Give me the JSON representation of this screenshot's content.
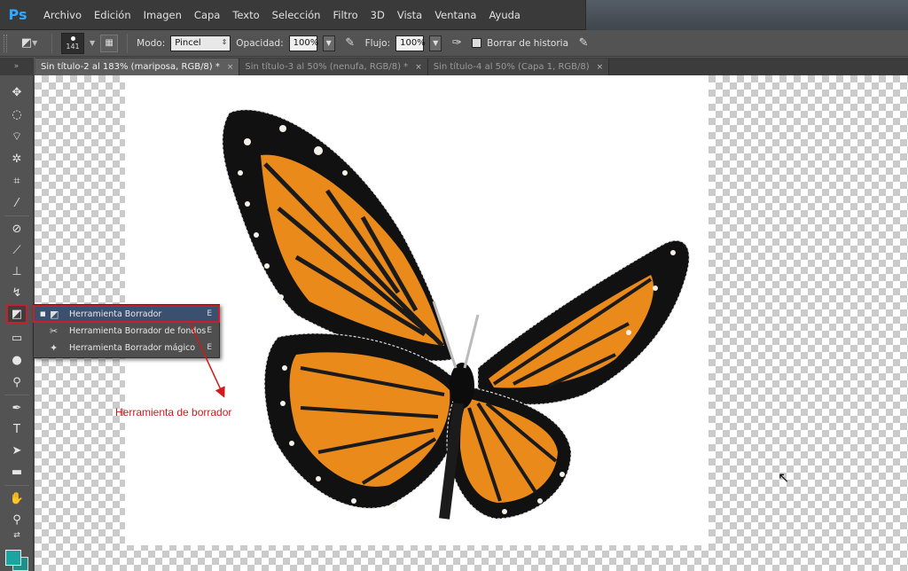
{
  "app": {
    "logo": "Ps"
  },
  "menu": [
    "Archivo",
    "Edición",
    "Imagen",
    "Capa",
    "Texto",
    "Selección",
    "Filtro",
    "3D",
    "Vista",
    "Ventana",
    "Ayuda"
  ],
  "options": {
    "brush_size": "141",
    "mode_label": "Modo:",
    "mode_value": "Pincel",
    "opacity_label": "Opacidad:",
    "opacity_value": "100%",
    "flow_label": "Flujo:",
    "flow_value": "100%",
    "erase_history_label": "Borrar de historia"
  },
  "tabs": [
    {
      "label": "Sin título-2 al 183% (mariposa, RGB/8) *",
      "close": "×",
      "active": true
    },
    {
      "label": "Sin título-3 al 50% (nenufa, RGB/8) *",
      "close": "×",
      "active": false
    },
    {
      "label": "Sin título-4 al 50% (Capa 1, RGB/8)",
      "close": "×",
      "active": false
    }
  ],
  "flyout": {
    "items": [
      {
        "label": "Herramienta Borrador",
        "shortcut": "E",
        "bullet": "■"
      },
      {
        "label": "Herramienta Borrador de fondos",
        "shortcut": "E",
        "bullet": ""
      },
      {
        "label": "Herramienta Borrador mágico",
        "shortcut": "E",
        "bullet": ""
      }
    ]
  },
  "annotation": {
    "text": "Herramienta de borrador",
    "color": "#d11a1a"
  },
  "colors": {
    "accent_red": "#c8202a",
    "foreground": "#1aa6a0",
    "background": "#1f8f8a"
  }
}
